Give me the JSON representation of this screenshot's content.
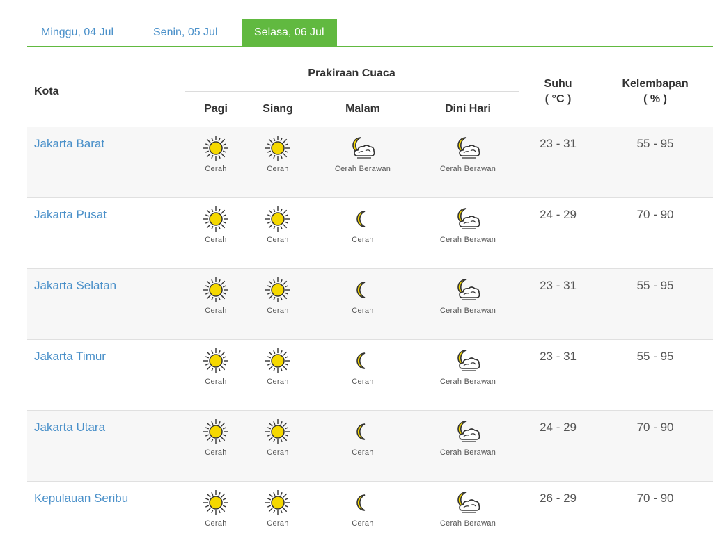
{
  "tabs": [
    {
      "label": "Minggu, 04 Jul"
    },
    {
      "label": "Senin, 05 Jul"
    },
    {
      "label": "Selasa, 06 Jul"
    }
  ],
  "table": {
    "kota_header": "Kota",
    "forecast_header": "Prakiraan Cuaca",
    "periods": [
      "Pagi",
      "Siang",
      "Malam",
      "Dini Hari"
    ],
    "suhu_header": "Suhu",
    "suhu_unit": "( °C )",
    "lembap_header": "Kelembapan",
    "lembap_unit": "( % )"
  },
  "colors": {
    "accent": "#61b940",
    "link": "#4a90c9",
    "sun": "#f5d800"
  },
  "rows": [
    {
      "city": "Jakarta Barat",
      "pagi": "Cerah",
      "siang": "Cerah",
      "malam": "Cerah Berawan",
      "dini": "Cerah Berawan",
      "suhu": "23 - 31",
      "lembap": "55 - 95"
    },
    {
      "city": "Jakarta Pusat",
      "pagi": "Cerah",
      "siang": "Cerah",
      "malam": "Cerah",
      "dini": "Cerah Berawan",
      "suhu": "24 - 29",
      "lembap": "70 - 90"
    },
    {
      "city": "Jakarta Selatan",
      "pagi": "Cerah",
      "siang": "Cerah",
      "malam": "Cerah",
      "dini": "Cerah Berawan",
      "suhu": "23 - 31",
      "lembap": "55 - 95"
    },
    {
      "city": "Jakarta Timur",
      "pagi": "Cerah",
      "siang": "Cerah",
      "malam": "Cerah",
      "dini": "Cerah Berawan",
      "suhu": "23 - 31",
      "lembap": "55 - 95"
    },
    {
      "city": "Jakarta Utara",
      "pagi": "Cerah",
      "siang": "Cerah",
      "malam": "Cerah",
      "dini": "Cerah Berawan",
      "suhu": "24 - 29",
      "lembap": "70 - 90"
    },
    {
      "city": "Kepulauan Seribu",
      "pagi": "Cerah",
      "siang": "Cerah",
      "malam": "Cerah",
      "dini": "Cerah Berawan",
      "suhu": "26 - 29",
      "lembap": "70 - 90"
    }
  ]
}
